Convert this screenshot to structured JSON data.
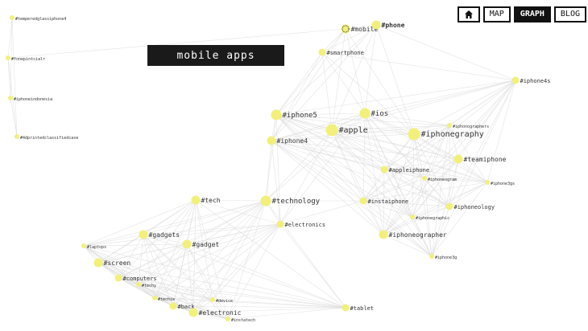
{
  "title": "mobile apps",
  "nav": {
    "home_icon": "home-icon",
    "map": "MAP",
    "graph": "GRAPH",
    "blog": "BLOG",
    "active": "graph"
  },
  "colors": {
    "node": "#f2f07a",
    "edge": "#dcdcdc",
    "title_bg": "#1a1a1a"
  },
  "nodes": [
    {
      "id": "n0",
      "label": "#temperedglassiphone4",
      "size": "xs"
    },
    {
      "id": "n1",
      "label": "#fonepintcialr",
      "size": "xs"
    },
    {
      "id": "n2",
      "label": "#iphoneindonesia",
      "size": "xs"
    },
    {
      "id": "n3",
      "label": "#4dprintedclassifiedcase",
      "size": "xs"
    },
    {
      "id": "n4",
      "label": "#mobile",
      "size": "m"
    },
    {
      "id": "n5",
      "label": "#phone",
      "size": "m"
    },
    {
      "id": "n6",
      "label": "#smartphone",
      "size": "s"
    },
    {
      "id": "n7",
      "label": "#iphone4s",
      "size": "s"
    },
    {
      "id": "n8",
      "label": "#iphone5",
      "size": "l"
    },
    {
      "id": "n9",
      "label": "#ios",
      "size": "l"
    },
    {
      "id": "n10",
      "label": "#apple",
      "size": "xl"
    },
    {
      "id": "n11",
      "label": "#iphonegraphy",
      "size": "xl"
    },
    {
      "id": "n12",
      "label": "#iphonographers",
      "size": "xs"
    },
    {
      "id": "n13",
      "label": "#iphone4",
      "size": "m"
    },
    {
      "id": "n14",
      "label": "#teamiphone",
      "size": "m"
    },
    {
      "id": "n15",
      "label": "#appleiphone",
      "size": "s"
    },
    {
      "id": "n16",
      "label": "#iphoneogram",
      "size": "xs"
    },
    {
      "id": "n17",
      "label": "#iphone3gs",
      "size": "xs"
    },
    {
      "id": "n18",
      "label": "#tech",
      "size": "m"
    },
    {
      "id": "n19",
      "label": "#technology",
      "size": "l"
    },
    {
      "id": "n20",
      "label": "#instaiphone",
      "size": "s"
    },
    {
      "id": "n21",
      "label": "#iphoneology",
      "size": "s"
    },
    {
      "id": "n22",
      "label": "#electronics",
      "size": "s"
    },
    {
      "id": "n23",
      "label": "#iphonegraphic",
      "size": "xs"
    },
    {
      "id": "n24",
      "label": "#iphoneographer",
      "size": "m"
    },
    {
      "id": "n25",
      "label": "#gadgets",
      "size": "m"
    },
    {
      "id": "n26",
      "label": "#gadget",
      "size": "m"
    },
    {
      "id": "n27",
      "label": "#laptops",
      "size": "xs"
    },
    {
      "id": "n28",
      "label": "#screen",
      "size": "m"
    },
    {
      "id": "n29",
      "label": "#iphone3g",
      "size": "xs"
    },
    {
      "id": "n30",
      "label": "#computers",
      "size": "s"
    },
    {
      "id": "n31",
      "label": "#techy",
      "size": "xs"
    },
    {
      "id": "n32",
      "label": "#techie",
      "size": "xs"
    },
    {
      "id": "n33",
      "label": "#device",
      "size": "xs"
    },
    {
      "id": "n34",
      "label": "#back",
      "size": "s"
    },
    {
      "id": "n35",
      "label": "#electronic",
      "size": "m"
    },
    {
      "id": "n36",
      "label": "#instatech",
      "size": "xs"
    },
    {
      "id": "n37",
      "label": "#tablet",
      "size": "s"
    }
  ]
}
